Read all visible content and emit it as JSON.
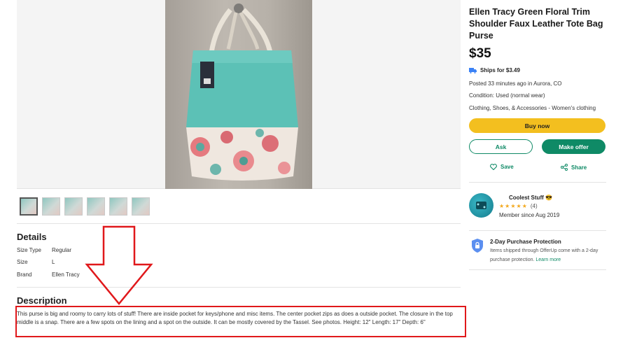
{
  "listing": {
    "title": "Ellen Tracy Green Floral Trim Shoulder Faux Leather Tote Bag Purse",
    "price": "$35",
    "shipping": "Ships for $3.49",
    "posted": "Posted 33 minutes ago in Aurora, CO",
    "condition": "Condition: Used (normal wear)",
    "category": "Clothing, Shoes, & Accessories - Women's clothing"
  },
  "actions": {
    "buy_now": "Buy now",
    "ask": "Ask",
    "make_offer": "Make offer",
    "save": "Save",
    "share": "Share"
  },
  "seller": {
    "name": "Coolest Stuff 😎",
    "rating": 5,
    "rating_count": "(4)",
    "member_since": "Member since Aug 2019"
  },
  "protection": {
    "title": "2-Day Purchase Protection",
    "text": "Items shipped through OfferUp come with a 2-day purchase protection.",
    "link": "Learn more"
  },
  "details": {
    "heading": "Details",
    "rows": [
      {
        "key": "Size Type",
        "value": "Regular"
      },
      {
        "key": "Size",
        "value": "L"
      },
      {
        "key": "Brand",
        "value": "Ellen Tracy"
      }
    ]
  },
  "description": {
    "heading": "Description",
    "text": "This purse is big and roomy to carry lots of stuff! There are inside pocket for keys/phone and misc items. The center pocket zips as does a outside pocket. The closure in the top middle is a snap. There are a few spots on the lining and a spot on the outside. It can be mostly covered by the Tassel. See photos. Height: 12\" Length: 17\" Depth: 6\""
  },
  "gallery": {
    "thumbnail_count": 6,
    "selected_index": 0
  },
  "colors": {
    "buy_button": "#f3bf1f",
    "brand_green": "#0f8a66",
    "highlight_red": "#e0181b",
    "bag_teal": "#5fc0b8"
  },
  "icons": [
    "truck-icon",
    "heart-icon",
    "share-icon",
    "star-icon",
    "shield-icon",
    "arrow-annotation-icon"
  ]
}
